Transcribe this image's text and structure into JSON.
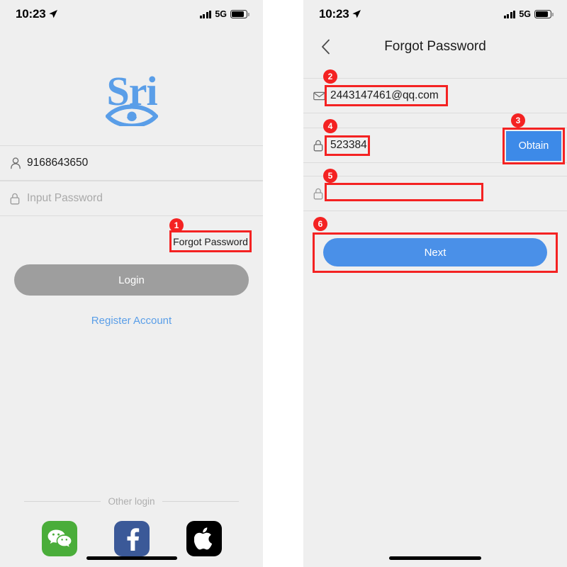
{
  "status_bar": {
    "time": "10:23",
    "location_icon": "location-arrow-icon",
    "signal_icon": "signal-bars-icon",
    "network": "5G",
    "battery_icon": "battery-icon"
  },
  "login_screen": {
    "logo": {
      "text": "Sri",
      "color": "#5a9ee8",
      "mark": "eye-icon"
    },
    "username_field": {
      "icon": "person-icon",
      "value": "9168643650"
    },
    "password_field": {
      "icon": "lock-icon",
      "placeholder": "Input Password",
      "value": ""
    },
    "forgot_password_label": "Forgot Password",
    "login_button_label": "Login",
    "register_link_label": "Register Account",
    "other_login_label": "Other login",
    "social_buttons": [
      {
        "name": "wechat",
        "icon": "wechat-icon",
        "color": "#4aad3a"
      },
      {
        "name": "facebook",
        "icon": "facebook-icon",
        "color": "#3b5998"
      },
      {
        "name": "apple",
        "icon": "apple-icon",
        "color": "#000000"
      }
    ]
  },
  "forgot_password_screen": {
    "back_icon": "chevron-left-icon",
    "title": "Forgot Password",
    "email_field": {
      "icon": "envelope-icon",
      "value": "2443147461@qq.com"
    },
    "code_field": {
      "icon": "lock-icon",
      "value": "523384"
    },
    "obtain_button_label": "Obtain",
    "new_password_field": {
      "icon": "lock-icon",
      "placeholder": "",
      "value": ""
    },
    "next_button_label": "Next"
  },
  "annotations": {
    "accent_color": "#f42222",
    "steps": [
      {
        "number": "1",
        "target": "forgot-password-link"
      },
      {
        "number": "2",
        "target": "email-field"
      },
      {
        "number": "3",
        "target": "obtain-button"
      },
      {
        "number": "4",
        "target": "code-field"
      },
      {
        "number": "5",
        "target": "new-password-field"
      },
      {
        "number": "6",
        "target": "next-button"
      }
    ]
  }
}
